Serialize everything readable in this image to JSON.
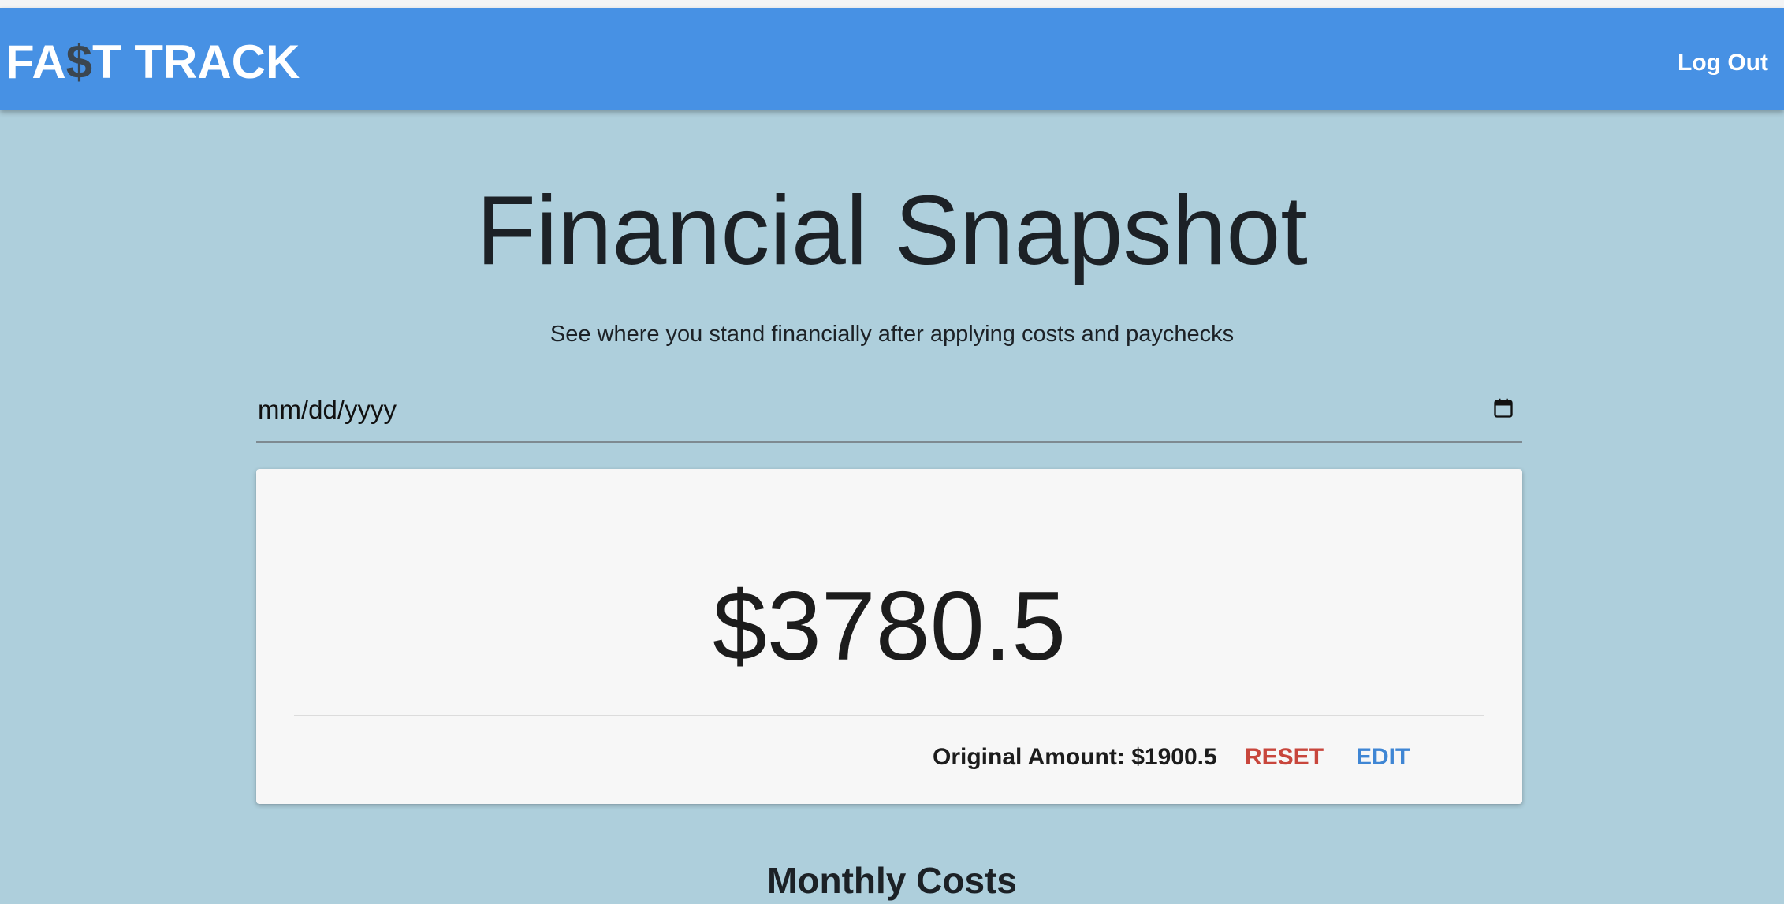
{
  "navbar": {
    "logo": {
      "part1": "FA",
      "symbol": "$",
      "part2": "T TRACK"
    },
    "logout_label": "Log Out"
  },
  "main": {
    "title": "Financial Snapshot",
    "subtitle": "See where you stand financially after applying costs and paychecks",
    "date_input": {
      "placeholder": "mm/dd/yyyy",
      "value": "",
      "icon": "calendar-icon"
    },
    "balance_card": {
      "balance": "$3780.5",
      "original_amount": "Original Amount: $1900.5",
      "reset_label": "RESET",
      "edit_label": "EDIT"
    },
    "next_section_title": "Monthly Costs"
  },
  "colors": {
    "navbar_bg": "#4791e4",
    "page_bg": "#aecfdc",
    "card_bg": "#f7f7f7",
    "reset": "#c8463c",
    "edit": "#3f86d4",
    "logo_symbol": "#3b4650"
  }
}
